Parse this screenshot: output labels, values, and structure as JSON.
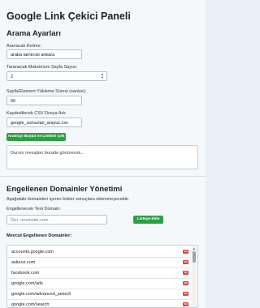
{
  "page": {
    "title": "Google Link Çekici Paneli"
  },
  "search_settings": {
    "title": "Arama Ayarları",
    "keyword": {
      "label": "Aranacak Kelime:",
      "value": "araba tamircisi ankara"
    },
    "max_pages": {
      "label": "Taranacak Maksimum Sayfa Sayısı:",
      "value": "2"
    },
    "wait_time": {
      "label": "Sayfa/Element Yükleme Süresi (saniye):",
      "value": "50"
    },
    "csv_file": {
      "label": "Kaydedilecek CSV Dosya Adı:",
      "value": "google_sonuclari_arayuz.csv"
    },
    "start_button": "Aramayı Başlat ve Linkleri Çek"
  },
  "status": {
    "text": "Durum mesajları burada görünecek..."
  },
  "blocked_domains": {
    "title": "Engellenen Domainler Yönetimi",
    "description": "Aşağıdaki domainleri içeren linkler sonuçlara eklenmeyecektir.",
    "new_domain": {
      "label": "Engellenecek Yeni Domain:",
      "placeholder": "Örn: orneksite.com"
    },
    "add_button": "Listeye Ekle",
    "list_title": "Mevcut Engellenen Domainler:",
    "delete_label": "Sil",
    "items": [
      "accounts.google.com",
      "askece.com",
      "facebook.com",
      "google.com/ads",
      "google.com/advanced_search",
      "google.com/search"
    ]
  },
  "colors": {
    "accent": "#2e9e45",
    "danger": "#e0453f"
  }
}
